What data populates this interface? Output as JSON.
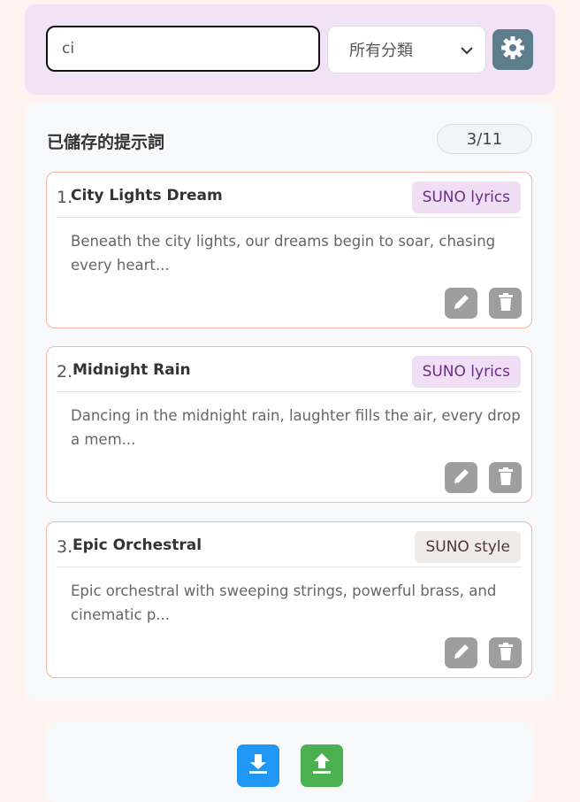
{
  "search": {
    "value": "ci"
  },
  "category": {
    "selected": "所有分類"
  },
  "panel": {
    "title": "已儲存的提示詞",
    "count": "3/11"
  },
  "cards": [
    {
      "index": "1.",
      "title": "City Lights Dream",
      "tag": "SUNO lyrics",
      "preview": "Beneath the city lights, our dreams begin to soar, chasing every heart..."
    },
    {
      "index": "2.",
      "title": "Midnight Rain",
      "tag": "SUNO lyrics",
      "preview": "Dancing in the midnight rain, laughter fills the air, every drop a mem..."
    },
    {
      "index": "3.",
      "title": "Epic Orchestral",
      "tag": "SUNO style",
      "preview": "Epic orchestral with sweeping strings, powerful brass, and cinematic p..."
    }
  ],
  "colors": {
    "top_bar": "#f2e2f5",
    "settings": "#5f7e8d",
    "card_border": "#f2b9a2",
    "tag_lyrics": "#f0dff4",
    "tag_style": "#f1ebe8",
    "download": "#2196f3",
    "upload": "#4caf50"
  },
  "icons": {
    "settings": "gear-icon",
    "edit": "pencil-icon",
    "delete": "trash-icon",
    "export": "download-icon",
    "import": "upload-icon"
  }
}
